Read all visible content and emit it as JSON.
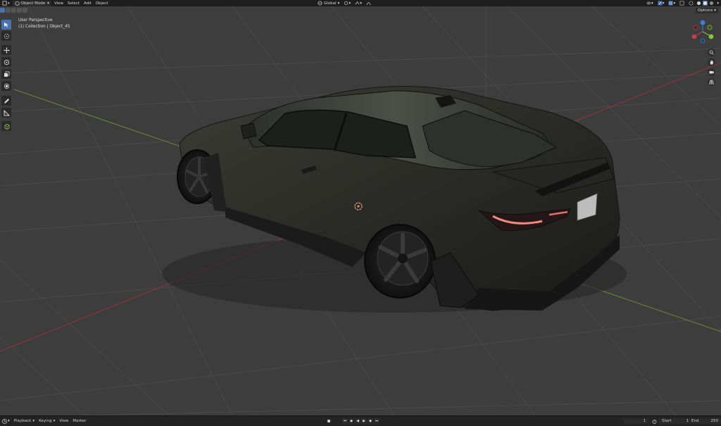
{
  "header": {
    "mode_label": "Object Mode",
    "menus": [
      "View",
      "Select",
      "Add",
      "Object"
    ],
    "transform_orientation": "Global",
    "options_label": "Options"
  },
  "viewport": {
    "perspective_label": "User Perspective",
    "collection_label": "(1) Collection | Object_45",
    "gizmo_axes": {
      "x": "X",
      "y": "Y",
      "z": "Z"
    },
    "colors": {
      "x_axis": "#c8394c",
      "y_axis": "#8cc43a",
      "z_axis": "#3b7fd9"
    }
  },
  "toolbar": {
    "tools": [
      "select-box",
      "cursor",
      "move",
      "rotate",
      "scale",
      "transform",
      "annotate",
      "measure",
      "add-cube"
    ]
  },
  "timeline": {
    "menus": [
      "Playback",
      "Keying",
      "View",
      "Marker"
    ],
    "current_frame": "1",
    "start_label": "Start",
    "start_value": "1",
    "end_label": "End",
    "end_value": "250"
  }
}
